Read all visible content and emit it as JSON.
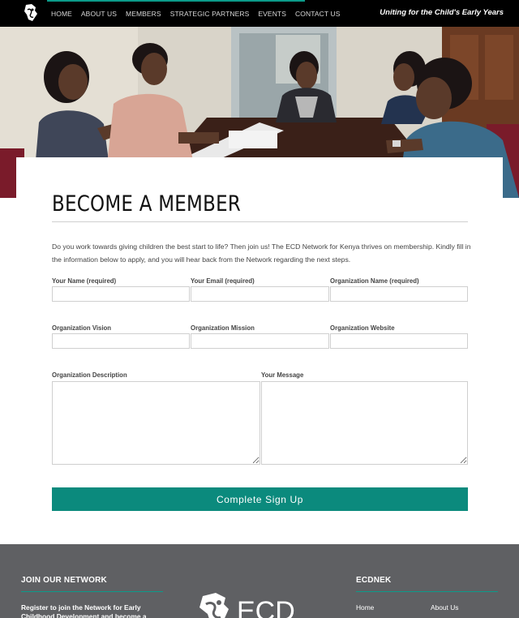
{
  "nav": {
    "links": [
      "HOME",
      "ABOUT US",
      "MEMBERS",
      "STRATEGIC PARTNERS",
      "EVENTS",
      "CONTACT US"
    ],
    "tagline": "Uniting for the Child's Early Years",
    "accent_color": "#0b9b8a",
    "logo_icon": "kenya-map-logo-icon"
  },
  "hero": {
    "photo": "group of women meeting around a conference table with laptops"
  },
  "main": {
    "title": "BECOME A MEMBER",
    "intro": "Do you work towards giving children the best start to life? Then join us! The ECD Network for Kenya thrives on membership. Kindly fill in the information below to apply, and you will hear back from the Network regarding the next steps.",
    "fields": {
      "name": "Your Name (required)",
      "email": "Your Email (required)",
      "org_name": "Organization Name (required)",
      "vision": "Organization Vision",
      "mission": "Organization Mission",
      "website": "Organization Website",
      "description": "Organization Description",
      "message": "Your Message"
    },
    "submit_label": "Complete  Sign  Up",
    "button_color": "#0b8a7d"
  },
  "footer": {
    "join_heading": "JOIN OUR NETWORK",
    "join_text": "Register to join the Network for Early Childhood Development and become a",
    "logo_text": "ECD",
    "ecdnek_heading": "ECDNEK",
    "links": [
      "Home",
      "About Us"
    ],
    "background_color": "#5f6063"
  }
}
